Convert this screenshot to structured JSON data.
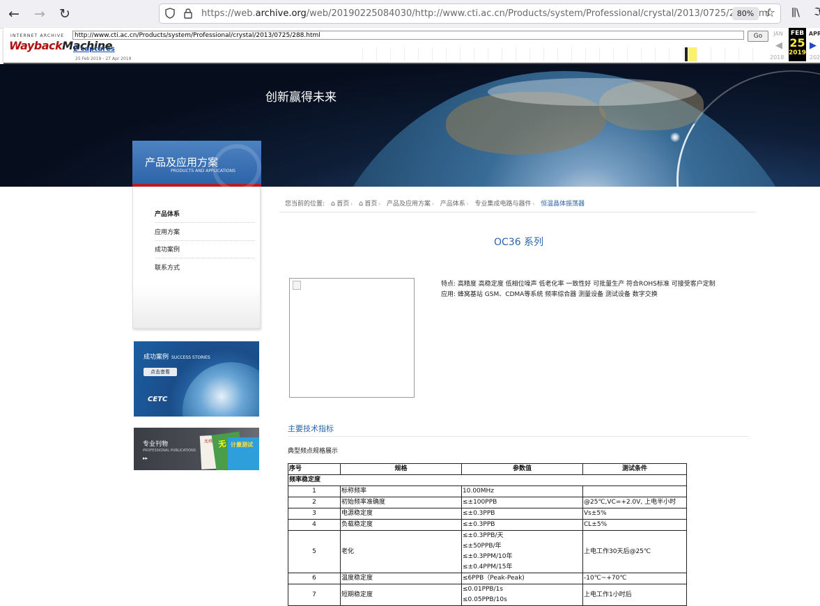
{
  "browser": {
    "url_prefix": "https://web.",
    "url_domain": "archive.org",
    "url_rest": "/web/20190225084030/http://www.cti.ac.cn/Products/system/Professional/crystal/2013/0725/288.html",
    "zoom": "80%"
  },
  "wayback": {
    "logo_top": "INTERNET ARCHIVE",
    "logo_a": "Wayback",
    "logo_b": "Machine",
    "url_value": "http://www.cti.ac.cn/Products/system/Professional/crystal/2013/0725/288.html",
    "go_label": "Go",
    "captures": "2 captures",
    "range": "25 Feb 2019 - 27 Apr 2019",
    "prev_month": "JAN",
    "cur_month": "FEB",
    "cur_day": "25",
    "cur_year": "2019",
    "next_month": "APR",
    "prev_year": "2018",
    "next_year": "202"
  },
  "banner": {
    "slogan": "创新赢得未来"
  },
  "sidebar": {
    "title": "产品及应用方案",
    "subtitle": "PRODUCTS AND APPLICATIONS",
    "items": [
      "产品体系",
      "应用方案",
      "成功案例",
      "联系方式"
    ]
  },
  "ads": {
    "success_title": "成功案例",
    "success_sub": "SUCCESS STORIES",
    "success_btn": "点击查看",
    "success_logo": "CETC",
    "pub_title": "专业刊物",
    "pub_sub": "PROFESSIONAL PUBLICATIONS",
    "pub_arrow": "▸▸",
    "mag_a": "无线",
    "mag_b": "无",
    "mag_c": "计量测试"
  },
  "breadcrumb": {
    "label": "您当前的位置:",
    "items": [
      "首页",
      "首页",
      "产品及应用方案",
      "产品体系",
      "专业集成电路与器件",
      "恒温晶体振荡器"
    ]
  },
  "product": {
    "title": "OC36 系列",
    "features": "特点: 高精度 高稳定度 低相位噪声 低老化率 一致性好 可批量生产 符合ROHS标准 可接受客户定制",
    "applications": "应用: 蜂窝基站 GSM、CDMA等系统 频率综合器 测量设备 测试设备 数字交换"
  },
  "specs": {
    "section_title": "主要技术指标",
    "subtitle": "典型频点规格展示",
    "headers": [
      "序号",
      "规格",
      "参数值",
      "测试条件"
    ],
    "group": "频率稳定度",
    "rows": [
      {
        "no": "1",
        "spec": "标称频率",
        "value": [
          "10.00MHz"
        ],
        "cond": ""
      },
      {
        "no": "2",
        "spec": "初始频率准确度",
        "value": [
          "≤±100PPB"
        ],
        "cond": "@25℃,VC=+2.0V, 上电半小时"
      },
      {
        "no": "3",
        "spec": "电源稳定度",
        "value": [
          "≤±0.3PPB"
        ],
        "cond": "Vs±5%"
      },
      {
        "no": "4",
        "spec": "负载稳定度",
        "value": [
          "≤±0.3PPB"
        ],
        "cond": "CL±5%"
      },
      {
        "no": "5",
        "spec": "老化",
        "value": [
          "≤±0.3PPB/天",
          "≤±50PPB/年",
          "≤±0.3PPM/10年",
          "≤±0.4PPM/15年"
        ],
        "cond": "上电工作30天后@25℃"
      },
      {
        "no": "6",
        "spec": "温度稳定度",
        "value": [
          "≤6PPB（Peak-Peak)"
        ],
        "cond": "-10℃~+70℃"
      },
      {
        "no": "7",
        "spec": "短期稳定度",
        "value": [
          "≤0.01PPB/1s",
          "≤0.05PPB/10s"
        ],
        "cond": "上电工作1小时后"
      }
    ]
  }
}
